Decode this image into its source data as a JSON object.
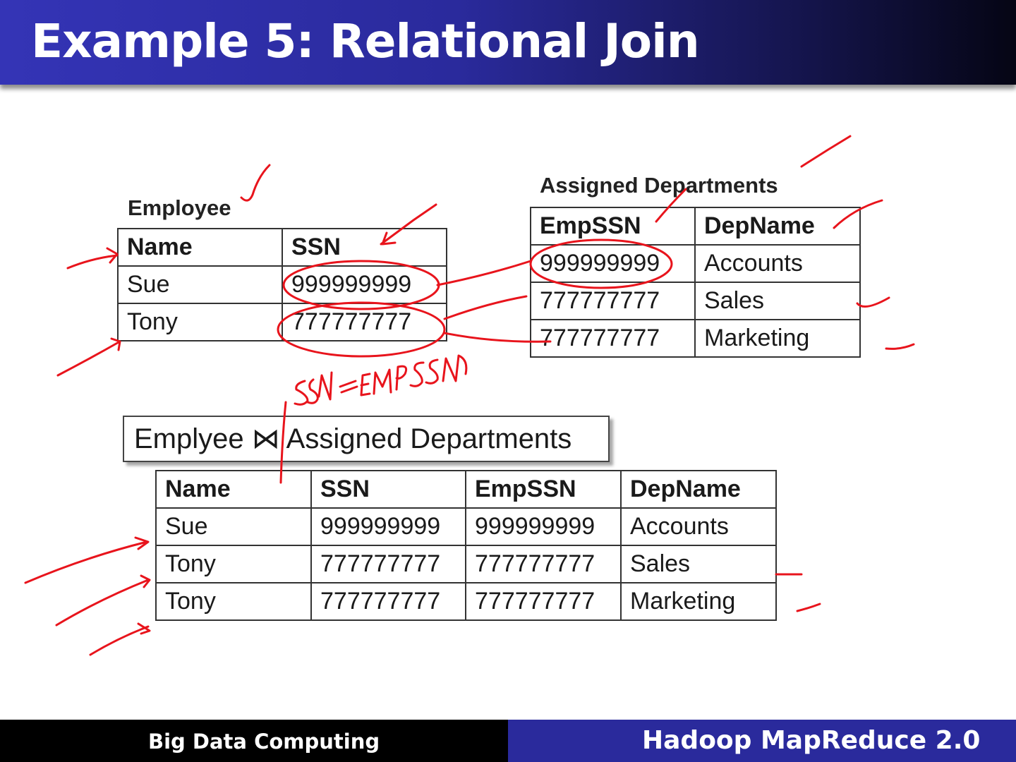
{
  "slide": {
    "title": "Example 5: Relational Join",
    "footer_left": "Big Data Computing",
    "footer_right": "Hadoop MapReduce 2.0"
  },
  "employee_table": {
    "caption": "Employee",
    "headers": [
      "Name",
      "SSN"
    ],
    "rows": [
      [
        "Sue",
        "999999999"
      ],
      [
        "Tony",
        "777777777"
      ]
    ]
  },
  "assigned_table": {
    "caption": "Assigned Departments",
    "headers": [
      "EmpSSN",
      "DepName"
    ],
    "rows": [
      [
        "999999999",
        "Accounts"
      ],
      [
        "777777777",
        "Sales"
      ],
      [
        "777777777",
        "Marketing"
      ]
    ]
  },
  "join_label": "Emplyee ⋈ Assigned Departments",
  "join_table": {
    "headers": [
      "Name",
      "SSN",
      "EmpSSN",
      "DepName"
    ],
    "rows": [
      [
        "Sue",
        "999999999",
        "999999999",
        "Accounts"
      ],
      [
        "Tony",
        "777777777",
        "777777777",
        "Sales"
      ],
      [
        "Tony",
        "777777777",
        "777777777",
        "Marketing"
      ]
    ]
  },
  "annotation": {
    "handwritten_text": "SSN = EMPSSN",
    "ink_color": "#e8141c"
  }
}
